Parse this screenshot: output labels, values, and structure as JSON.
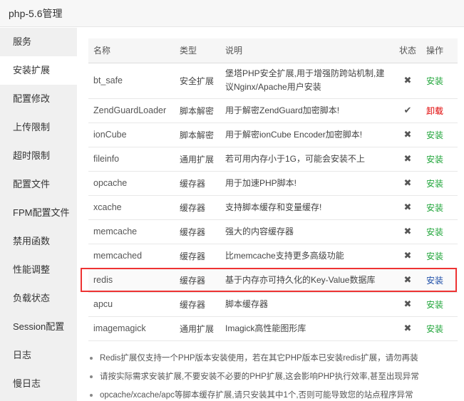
{
  "window": {
    "title": "php-5.6管理"
  },
  "sidebar": {
    "items": [
      {
        "label": "服务"
      },
      {
        "label": "安装扩展"
      },
      {
        "label": "配置修改"
      },
      {
        "label": "上传限制"
      },
      {
        "label": "超时限制"
      },
      {
        "label": "配置文件"
      },
      {
        "label": "FPM配置文件"
      },
      {
        "label": "禁用函数"
      },
      {
        "label": "性能调整"
      },
      {
        "label": "负载状态"
      },
      {
        "label": "Session配置"
      },
      {
        "label": "日志"
      },
      {
        "label": "慢日志"
      }
    ],
    "active_index": 1
  },
  "table": {
    "headers": {
      "name": "名称",
      "type": "类型",
      "desc": "说明",
      "status": "状态",
      "action": "操作"
    },
    "rows": [
      {
        "name": "bt_safe",
        "type": "安全扩展",
        "desc": "堡塔PHP安全扩展,用于增强防跨站机制,建议Nginx/Apache用户安装",
        "status": "✖",
        "action": "安装"
      },
      {
        "name": "ZendGuardLoader",
        "type": "脚本解密",
        "desc": "用于解密ZendGuard加密脚本!",
        "status": "✔",
        "action": "卸载"
      },
      {
        "name": "ionCube",
        "type": "脚本解密",
        "desc": "用于解密ionCube Encoder加密脚本!",
        "status": "✖",
        "action": "安装"
      },
      {
        "name": "fileinfo",
        "type": "通用扩展",
        "desc": "若可用内存小于1G，可能会安装不上",
        "status": "✖",
        "action": "安装"
      },
      {
        "name": "opcache",
        "type": "缓存器",
        "desc": "用于加速PHP脚本!",
        "status": "✖",
        "action": "安装"
      },
      {
        "name": "xcache",
        "type": "缓存器",
        "desc": "支持脚本缓存和变量缓存!",
        "status": "✖",
        "action": "安装"
      },
      {
        "name": "memcache",
        "type": "缓存器",
        "desc": "强大的内容缓存器",
        "status": "✖",
        "action": "安装"
      },
      {
        "name": "memcached",
        "type": "缓存器",
        "desc": "比memcache支持更多高级功能",
        "status": "✖",
        "action": "安装"
      },
      {
        "name": "redis",
        "type": "缓存器",
        "desc": "基于内存亦可持久化的Key-Value数据库",
        "status": "✖",
        "action": "安装"
      },
      {
        "name": "apcu",
        "type": "缓存器",
        "desc": "脚本缓存器",
        "status": "✖",
        "action": "安装"
      },
      {
        "name": "imagemagick",
        "type": "通用扩展",
        "desc": "Imagick高性能图形库",
        "status": "✖",
        "action": "安装"
      }
    ]
  },
  "notes": [
    "Redis扩展仅支持一个PHP版本安装使用，若在其它PHP版本已安装redis扩展，请勿再装",
    "请按实际需求安装扩展,不要安装不必要的PHP扩展,这会影响PHP执行效率,甚至出现异常",
    "opcache/xcache/apc等脚本缓存扩展,请只安装其中1个,否则可能导致您的站点程序异常"
  ],
  "colors": {
    "install": "#20a53a",
    "uninstall": "#e00000",
    "highlight": "#e33333",
    "highlight_action": "#1e4fa8"
  }
}
